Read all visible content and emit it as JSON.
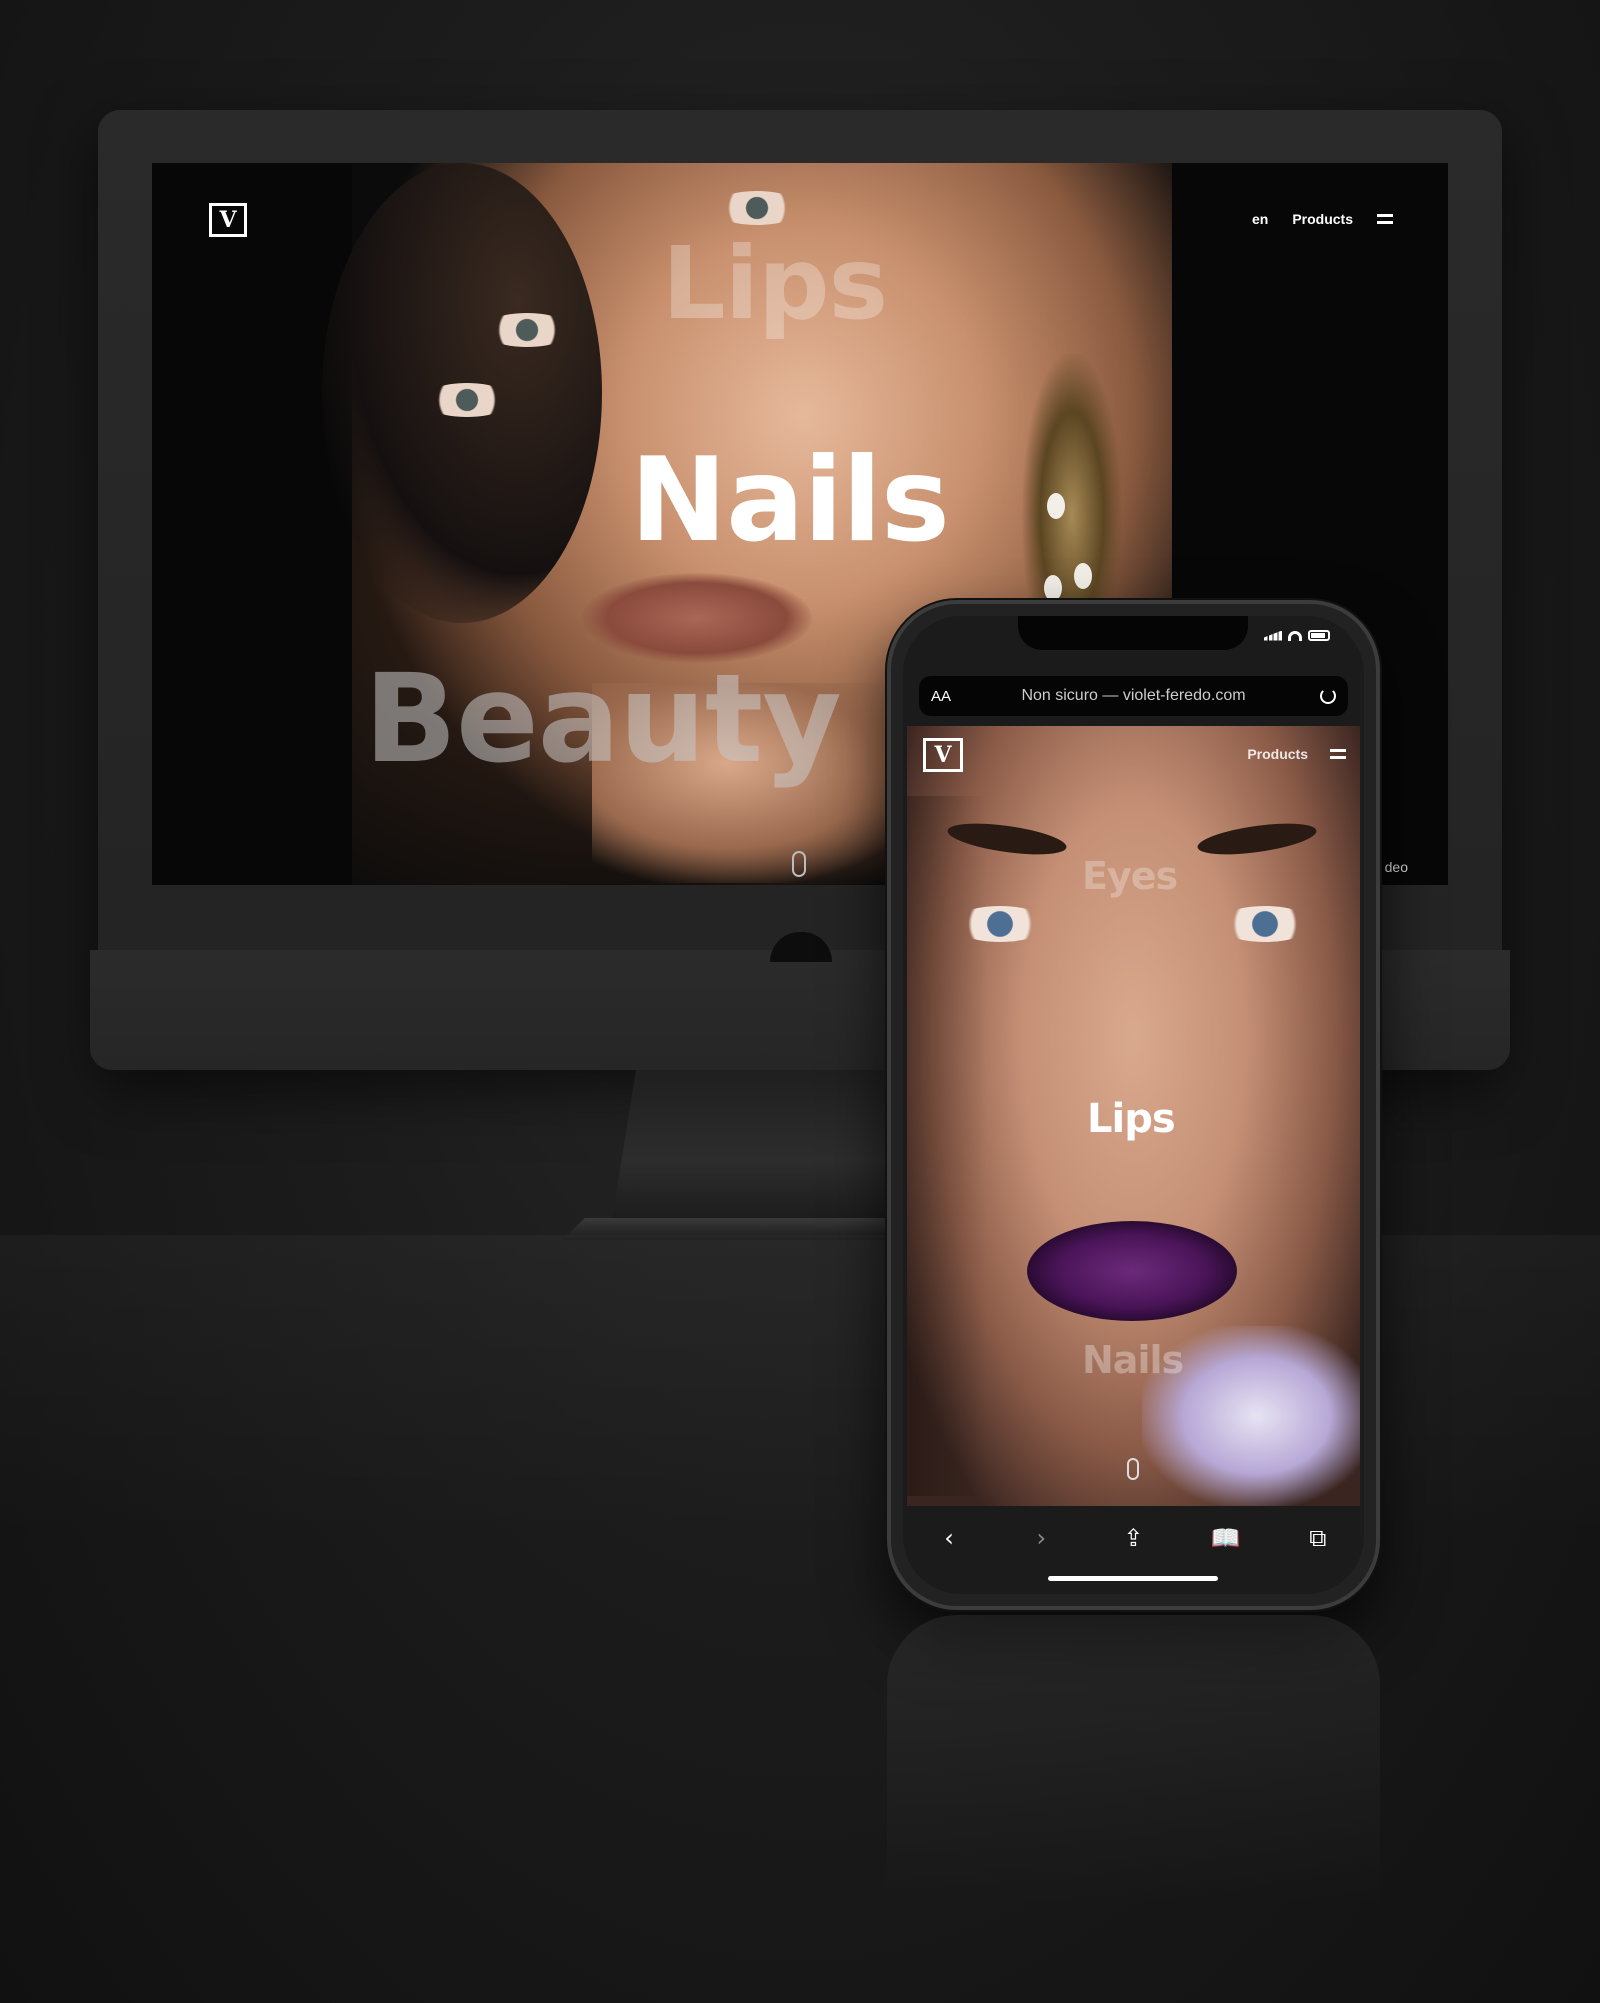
{
  "desktop": {
    "logo": "V",
    "nav": {
      "lang": "en",
      "products": "Products"
    },
    "words": [
      "Lips",
      "Nails",
      "Beauty"
    ],
    "video_label": "deo"
  },
  "mobile": {
    "browser": {
      "aa": "AA",
      "url": "Non sicuro — violet-feredo.com"
    },
    "logo": "V",
    "nav": {
      "products": "Products"
    },
    "words": [
      "Eyes",
      "Lips",
      "Nails"
    ],
    "toolbar": {
      "back": "‹",
      "forward": "›",
      "share": "⇪",
      "bookmarks": "📖",
      "tabs": "⧉"
    }
  },
  "colors": {
    "background": "#1c1c1c",
    "accent_lips": "#4a1458"
  }
}
